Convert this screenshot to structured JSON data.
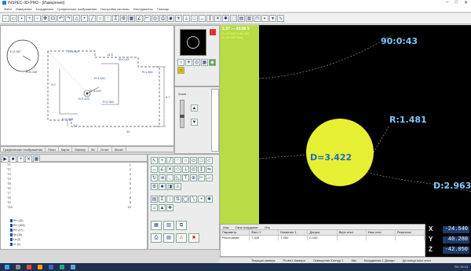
{
  "window": {
    "title": "INSPEC-3D-PRO - [Измерение]",
    "controls": [
      "–",
      "□",
      "✕"
    ]
  },
  "menu": [
    "Файл",
    "Измерение",
    "Координаты",
    "Графические изображения",
    "Настройки системы",
    "Инструменты",
    "Помощь"
  ],
  "drawing": {
    "labels": [
      "D:2.967",
      "R:6.046",
      "R:3.007",
      "R:4.161",
      "R:3.422",
      "R:2.963",
      "R:1.481",
      "D:3.422",
      "D:2.988",
      "90:0:43",
      "14.5",
      "4.0",
      "1.5",
      "5.7",
      "30"
    ]
  },
  "drawing_tabs": [
    "Графические изображения",
    "План",
    "Карта",
    "Миниф",
    "3D",
    "Отчет",
    "Model"
  ],
  "left_list": [
    {
      "name": "Т1",
      "value": "1"
    },
    {
      "name": "Т2",
      "value": "2"
    },
    {
      "name": "Т3",
      "value": "3"
    },
    {
      "name": "Т4",
      "value": "4"
    },
    {
      "name": "Т5",
      "value": "5"
    },
    {
      "name": "Т6",
      "value": "6"
    },
    {
      "name": "Т7",
      "value": "7"
    },
    {
      "name": "Т8",
      "value": "8"
    },
    {
      "name": "Т9",
      "value": "9"
    },
    {
      "name": "Т10",
      "value": "10"
    }
  ],
  "legend": [
    "Pt+ (12)",
    "Pt+ (100)",
    "Pt+ (17)",
    "Sn (16)",
    "Ln (2)",
    "Cr (1)"
  ],
  "scroll_panel": {
    "label": "Zoom"
  },
  "camera": {
    "overlay_title": "1:37 — 49.98 Y",
    "overlay_lines": [
      "X:-24.540 Y:40.280",
      "Z:-42.050 Mag"
    ],
    "labels": {
      "angle": "90:0:43",
      "radius": "R:1.481",
      "diameter_circle": "D=3.422",
      "diameter_right": "D:2.963"
    }
  },
  "results": {
    "tabs": [
      "Изм",
      "Окна координат",
      "Ось"
    ],
    "columns": [
      "Параметр",
      "Факт 1",
      "Номинал 1",
      "Допуск",
      "Верх.откл",
      "Ниж.откл",
      "Результат"
    ],
    "rows": [
      [
        "Расстояние",
        "7.320",
        "7.200",
        "0.100",
        "",
        "",
        ""
      ]
    ]
  },
  "xyz": [
    {
      "axis": "X",
      "value": "-24.540"
    },
    {
      "axis": "Y",
      "value": "40.280"
    },
    {
      "axis": "Z",
      "value": "-42.050"
    }
  ],
  "status": [
    "Текущая камера",
    "Probe1-Камера",
    "Освещение Контур 1",
    "Мм",
    "Координата 1 Декарт",
    "До конца осьх числ"
  ],
  "tray": "RU  15:24"
}
